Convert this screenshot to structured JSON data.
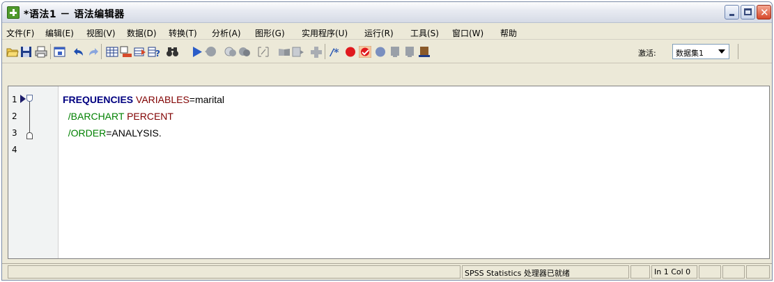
{
  "window": {
    "title": "*语法1 － 语法编辑器"
  },
  "menu": [
    "文件(F)",
    "编辑(E)",
    "视图(V)",
    "数据(D)",
    "转换(T)",
    "分析(A)",
    "图形(G)",
    "实用程序(U)",
    "运行(R)",
    "工具(S)",
    "窗口(W)",
    "帮助"
  ],
  "toolbar": {
    "activate_label": "激活:",
    "dataset_value": "数据集1",
    "icons": [
      "open-icon",
      "save-icon",
      "print-icon",
      "recall-dialog-icon",
      "undo-icon",
      "redo-icon",
      "goto-case-icon",
      "goto-variable-icon",
      "insert-cases-icon",
      "variables-info-icon",
      "find-icon",
      "run-selection-icon",
      "stop-icon",
      "bookmark-icon",
      "bookmark-next-icon",
      "toggle-comment-icon",
      "syntax-help-icon",
      "split-file-icon",
      "add-icon",
      "comment-icon",
      "breakpoint-icon",
      "validate-icon",
      "step-icon",
      "step-next-icon",
      "step-end-icon"
    ]
  },
  "editor": {
    "line_numbers": [
      "1",
      "2",
      "3",
      "4"
    ],
    "lines": [
      {
        "keyword": "FREQUENCIES",
        "sub": "VARIABLES",
        "rest": "=marital"
      },
      {
        "slash": "/BARCHART",
        "sub": "PERCENT",
        "rest": ""
      },
      {
        "slash": "/ORDER",
        "sub": "",
        "rest": "=ANALYSIS."
      }
    ]
  },
  "status": {
    "processor": "SPSS Statistics  处理器已就绪",
    "position": "In 1 Col 0"
  },
  "colors": {
    "keyword": "#000080",
    "subcommand": "#800000",
    "slash": "#008000",
    "chrome": "#ece9d8"
  }
}
